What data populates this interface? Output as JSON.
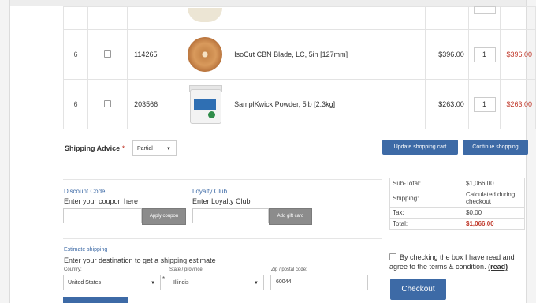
{
  "cart": {
    "rows": [
      {
        "qty": "",
        "sku": "",
        "name": "",
        "price": "",
        "quantity": "",
        "subtotal": ""
      },
      {
        "qty": "6",
        "sku": "114265",
        "name": "IsoCut CBN Blade, LC, 5in [127mm]",
        "price": "$396.00",
        "quantity": "1",
        "subtotal": "$396.00"
      },
      {
        "qty": "6",
        "sku": "203566",
        "name": "SamplKwick Powder, 5lb [2.3kg]",
        "price": "$263.00",
        "quantity": "1",
        "subtotal": "$263.00"
      }
    ]
  },
  "shipping_advice": {
    "label": "Shipping Advice",
    "required_mark": "*",
    "selected": "Partial"
  },
  "buttons": {
    "update_cart": "Update shopping cart",
    "continue_shopping": "Continue shopping",
    "apply_coupon": "Apply coupon",
    "add_gift_card": "Add gift card",
    "checkout": "Checkout"
  },
  "discount": {
    "title": "Discount Code",
    "note": "Enter your coupon here",
    "value": ""
  },
  "loyalty": {
    "title": "Loyalty Club",
    "note": "Enter Loyalty Club",
    "value": ""
  },
  "estimate": {
    "title": "Estimate shipping",
    "note": "Enter your destination to get a shipping estimate",
    "country_label": "Country:",
    "country": "United States",
    "state_label": "State / province:",
    "state_required": "*",
    "state": "Illinois",
    "zip_label": "Zip / postal code:",
    "zip": "60044"
  },
  "totals": {
    "subtotal_label": "Sub-Total:",
    "subtotal": "$1,066.00",
    "shipping_label": "Shipping:",
    "shipping": "Calculated during checkout",
    "tax_label": "Tax:",
    "tax": "$0.00",
    "total_label": "Total:",
    "total": "$1,066.00"
  },
  "terms": {
    "text": "By checking the box I have read and agree to the terms & condition.",
    "link": "(read)"
  },
  "colors": {
    "accent": "#3d6aa6",
    "price_red": "#c0392b"
  }
}
